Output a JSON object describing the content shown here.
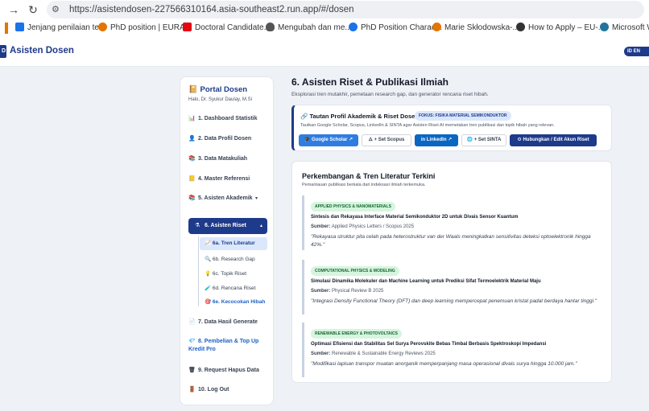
{
  "browser": {
    "url": "https://asistendosen-227566310164.asia-southeast2.run.app/#/dosen",
    "bookmarks": [
      {
        "label": "Jenjang penilaian te...",
        "icon": "document-icon",
        "color": "#1a73e8"
      },
      {
        "label": "PhD position | EURA...",
        "icon": "people-icon",
        "color": "#e37400"
      },
      {
        "label": "Doctoral Candidate...",
        "icon": "abb-logo-icon",
        "color": "#e30613"
      },
      {
        "label": "Mengubah dan me...",
        "icon": "apple-icon",
        "color": "#555555"
      },
      {
        "label": "PhD Position Charac...",
        "icon": "eye-icon",
        "color": "#1a73e8"
      },
      {
        "label": "Marie Skłodowska-...",
        "icon": "people-icon",
        "color": "#e37400"
      },
      {
        "label": "How to Apply – EU-...",
        "icon": "globe-icon",
        "color": "#333333"
      },
      {
        "label": "Microsoft Wo",
        "icon": "wordpress-icon",
        "color": "#21759b"
      }
    ]
  },
  "app": {
    "brand": "Asisten Dosen",
    "logo_text": "D",
    "right_badge": "ID  EN"
  },
  "sidebar": {
    "title": "Portal Dosen",
    "user": "Halo, Dr. Syukur Daulay, M.Si",
    "items": [
      {
        "label": "1. Dashboard Statistik",
        "icon": "📊"
      },
      {
        "label": "2. Data Profil Dosen",
        "icon": "👤"
      },
      {
        "label": "3. Data Matakuliah",
        "icon": "📚"
      },
      {
        "label": "4. Master Referensi",
        "icon": "📒"
      },
      {
        "label": "5. Asisten Akademik",
        "icon": "📚"
      },
      {
        "label": "6. Asisten Riset",
        "icon": "⚗"
      },
      {
        "label": "7. Data Hasil Generate",
        "icon": "📄"
      },
      {
        "label": "8. Pembelian & Top Up Kredit Pro",
        "icon": "💎"
      },
      {
        "label": "9. Request Hapus Data",
        "icon": "🗑"
      },
      {
        "label": "10. Log Out",
        "icon": "🚪"
      }
    ],
    "sub_items": [
      {
        "label": "6a. Tren Literatur",
        "icon": "📈"
      },
      {
        "label": "6b. Research Gap",
        "icon": "🔍"
      },
      {
        "label": "6c. Topik Riset",
        "icon": "💡"
      },
      {
        "label": "6d. Rencana Riset",
        "icon": "🧪"
      },
      {
        "label": "6e. Kecocokan Hibah",
        "icon": "🎯"
      }
    ]
  },
  "main": {
    "title": "6. Asisten Riset & Publikasi Ilmiah",
    "desc": "Eksplorasi tren mutakhir, pemetaan research gap, dan generator rencana riset hibah.",
    "profile_card": {
      "title": "Tautan Profil Akademik & Riset Dosen:",
      "focus": "FOKUS: FISIKA MATERIAL SEMIKONDUKTOR",
      "desc": "Tautkan Google Scholar, Scopus, LinkedIn & SINTA agar Asisten Riset AI memetakan tren publikasi dan topik hibah yang relevan.",
      "buttons": [
        {
          "label": "🎓 Google Scholar ↗",
          "bg": "#2f7de1",
          "fg": "#ffffff"
        },
        {
          "label": "🜂 + Set Scopus",
          "bg": "#ffffff",
          "fg": "#374151"
        },
        {
          "label": "in LinkedIn ↗",
          "bg": "#0a66c2",
          "fg": "#ffffff"
        },
        {
          "label": "🌐 + Set SINTA",
          "bg": "#ffffff",
          "fg": "#374151"
        },
        {
          "label": "⚙ Hubungkan / Edit Akun Riset",
          "bg": "#1e3a8a",
          "fg": "#ffffff"
        }
      ]
    },
    "trend_card": {
      "title": "Perkembangan & Tren Literatur Terkini",
      "subtitle": "Pemantauan publikasi berkala dari indeksasi ilmiah terkemuka.",
      "source_label": "Sumber:",
      "entries": [
        {
          "tag": "APPLIED PHYSICS & NANOMATERIALS",
          "title": "Sintesis dan Rekayasa Interface Material Semikonduktor 2D untuk Divais Sensor Kuantum",
          "source": "Applied Physics Letters / Scopus 2025",
          "quote": "\"Rekayasa struktur pita celah pada heterostruktur van der Waals meningkatkan sensitivitas deteksi optoelektronik hingga 42%.\""
        },
        {
          "tag": "COMPUTATIONAL PHYSICS & MODELING",
          "title": "Simulasi Dinamika Molekuler dan Machine Learning untuk Prediksi Sifat Termoelektrik Material Maju",
          "source": "Physical Review B 2025",
          "quote": "\"Integrasi Density Functional Theory (DFT) dan deep learning mempercepat penemuan kristal padat berdaya hantar tinggi.\""
        },
        {
          "tag": "RENEWABLE ENERGY & PHOTOVOLTAICS",
          "title": "Optimasi Efisiensi dan Stabilitas Sel Surya Perovskite Bebas Timbal Berbasis Spektroskopi Impedansi",
          "source": "Renewable & Sustainable Energy Reviews 2025",
          "quote": "\"Modifikasi lapisan transpor muatan anorganik memperpanjang masa operasional divais surya hingga 10.000 jam.\""
        }
      ]
    }
  }
}
